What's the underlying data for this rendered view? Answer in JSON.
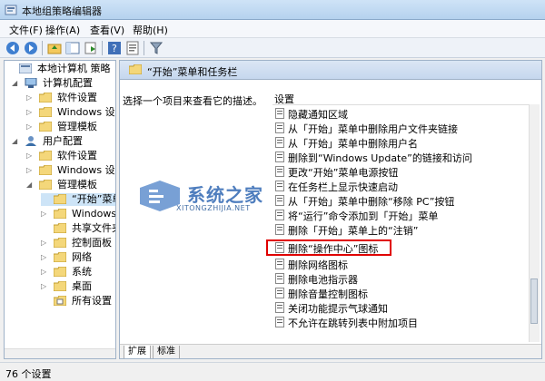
{
  "window": {
    "title": "本地组策略编辑器"
  },
  "menu": [
    "文件(F)",
    "操作(A)",
    "查看(V)",
    "帮助(H)"
  ],
  "toolbar": {
    "icons": [
      "back-icon",
      "forward-icon",
      "up-folder-icon",
      "show-hide-tree-icon",
      "export-icon",
      "help-icon",
      "properties-icon",
      "filter-icon"
    ]
  },
  "tree": {
    "nodes": [
      {
        "label": "本地计算机 策略"
      },
      {
        "label": "计算机配置"
      },
      {
        "label": "软件设置"
      },
      {
        "label": "Windows 设置"
      },
      {
        "label": "管理模板"
      },
      {
        "label": "用户配置"
      },
      {
        "label": "软件设置"
      },
      {
        "label": "Windows 设置"
      },
      {
        "label": "管理模板"
      },
      {
        "label": "“开始”菜单"
      },
      {
        "label": "Windows 组"
      },
      {
        "label": "共享文件夹"
      },
      {
        "label": "控制面板"
      },
      {
        "label": "网络"
      },
      {
        "label": "系统"
      },
      {
        "label": "桌面"
      },
      {
        "label": "所有设置"
      }
    ]
  },
  "main": {
    "header": "“开始”菜单和任务栏",
    "description": "选择一个项目来查看它的描述。",
    "column_header": "设置",
    "settings": [
      "隐藏通知区域",
      "从「开始」菜单中删除用户文件夹链接",
      "从「开始」菜单中删除用户名",
      "删除到“Windows Update”的链接和访问",
      "更改“开始”菜单电源按钮",
      "在任务栏上显示快速启动",
      "从「开始」菜单中删除“移除 PC”按钮",
      "将“运行”命令添加到「开始」菜单",
      "删除「开始」菜单上的“注销”",
      "删除“操作中心”图标",
      "删除网络图标",
      "删除电池指示器",
      "删除音量控制图标",
      "关闭功能提示气球通知",
      "不允许在跳转列表中附加项目"
    ],
    "tabs": [
      "扩展",
      "标准"
    ]
  },
  "watermark": {
    "title": "系统之家",
    "subtitle": "XITONGZHIJIA.NET"
  },
  "status": {
    "text": "76 个设置"
  }
}
